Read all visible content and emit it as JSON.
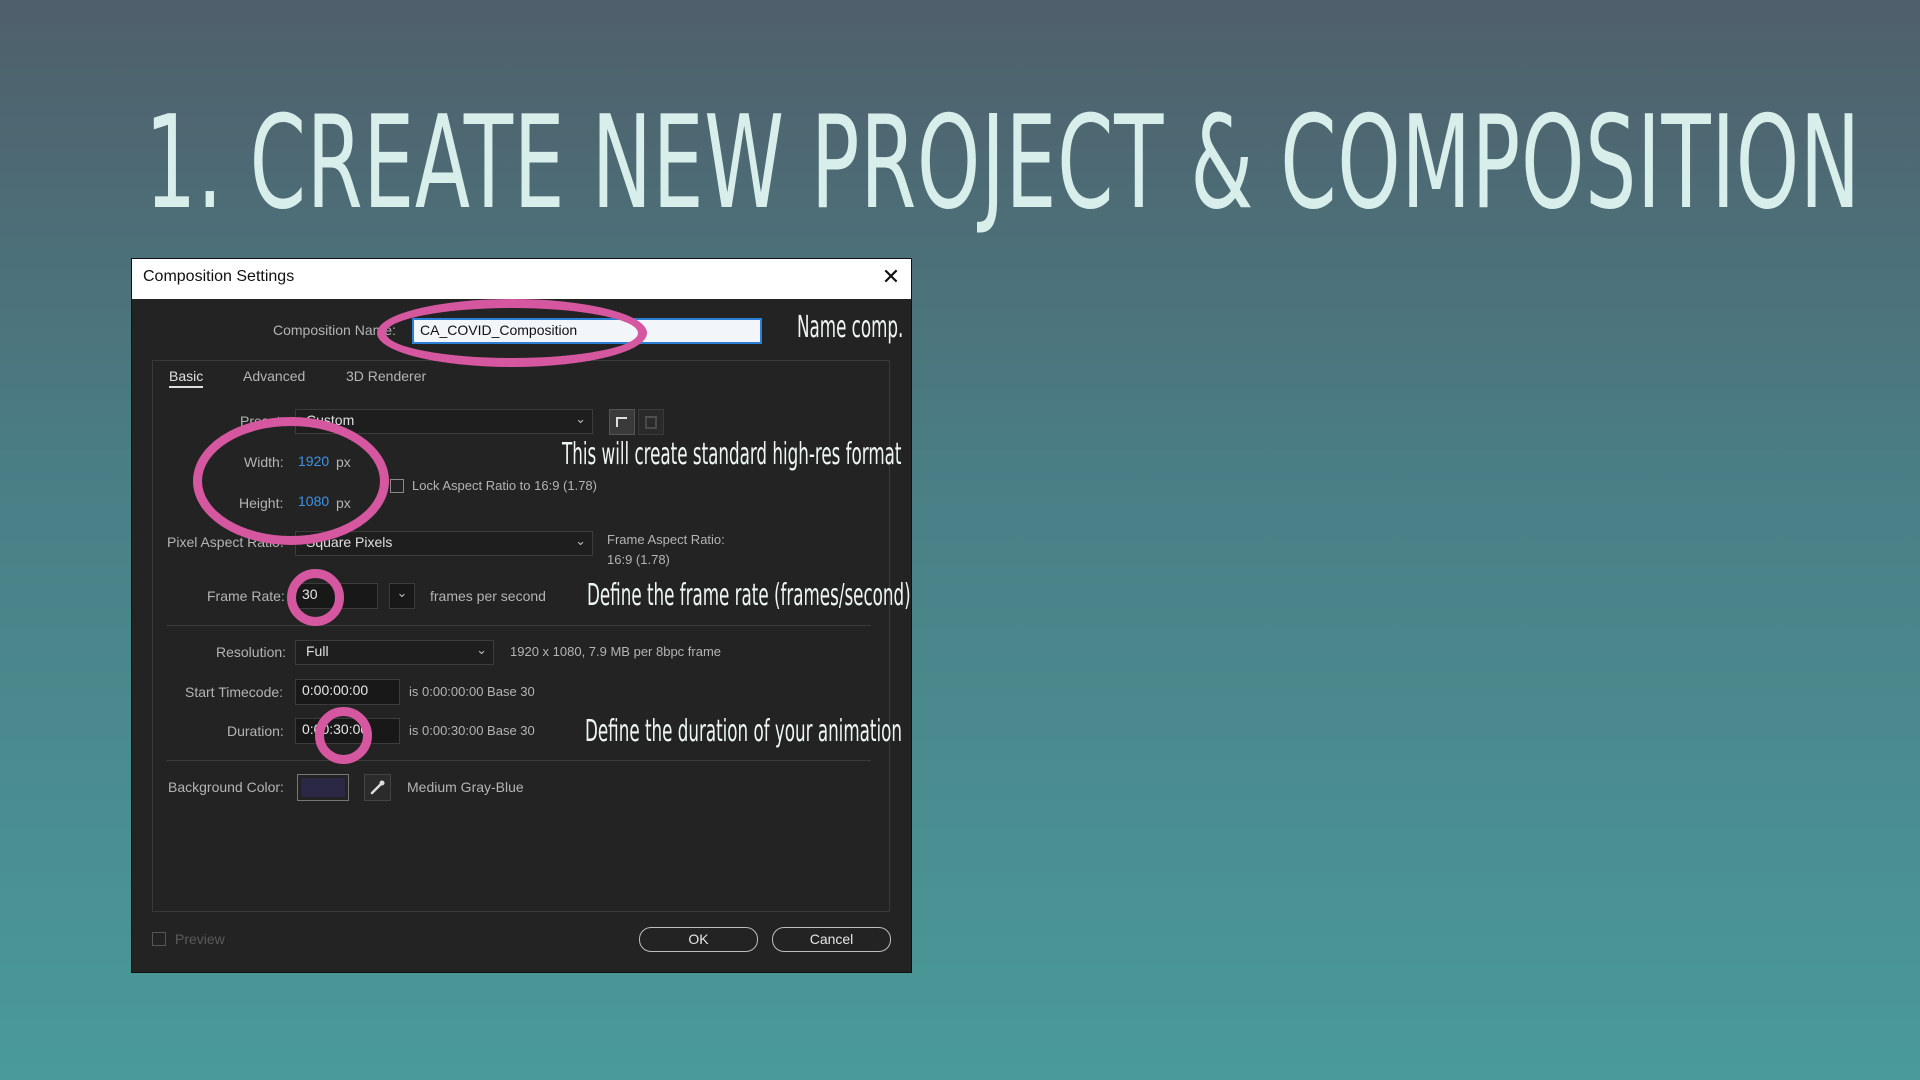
{
  "slide": {
    "title": "1. CREATE NEW PROJECT & COMPOSITION"
  },
  "dialog": {
    "title": "Composition Settings",
    "close_glyph": "✕",
    "composition_name_label": "Composition Name:",
    "composition_name_value": "CA_COVID_Composition",
    "tabs": [
      "Basic",
      "Advanced",
      "3D Renderer"
    ],
    "preset_label": "Preset:",
    "preset_value": "Custom",
    "width_label": "Width:",
    "width_value": "1920",
    "height_label": "Height:",
    "height_value": "1080",
    "px_unit": "px",
    "lock_aspect_label": "Lock Aspect Ratio to 16:9 (1.78)",
    "par_label": "Pixel Aspect Ratio:",
    "par_value": "Square Pixels",
    "far_label": "Frame Aspect Ratio:",
    "far_value": "16:9 (1.78)",
    "frame_rate_label": "Frame Rate:",
    "frame_rate_value": "30",
    "fps_label": "frames per second",
    "resolution_label": "Resolution:",
    "resolution_value": "Full",
    "resolution_info": "1920 x 1080, 7.9 MB per 8bpc frame",
    "start_tc_label": "Start Timecode:",
    "start_tc_value": "0:00:00:00",
    "start_tc_info": "is 0:00:00:00  Base 30",
    "duration_label": "Duration:",
    "duration_value": "0:00:30:00",
    "duration_info": "is 0:00:30:00  Base 30",
    "bg_color_label": "Background Color:",
    "bg_color_name": "Medium Gray-Blue",
    "bg_color_hex": "#2b2845",
    "preview_label": "Preview",
    "ok_label": "OK",
    "cancel_label": "Cancel"
  },
  "annotations": {
    "name_comp": "Name comp.",
    "high_res": "This will create standard high-res format",
    "frame_rate": "Define the frame rate (frames/second)",
    "duration": "Define the duration of your animation"
  },
  "colors": {
    "highlight": "#d4579f",
    "accent_blue": "#3f93e6"
  }
}
